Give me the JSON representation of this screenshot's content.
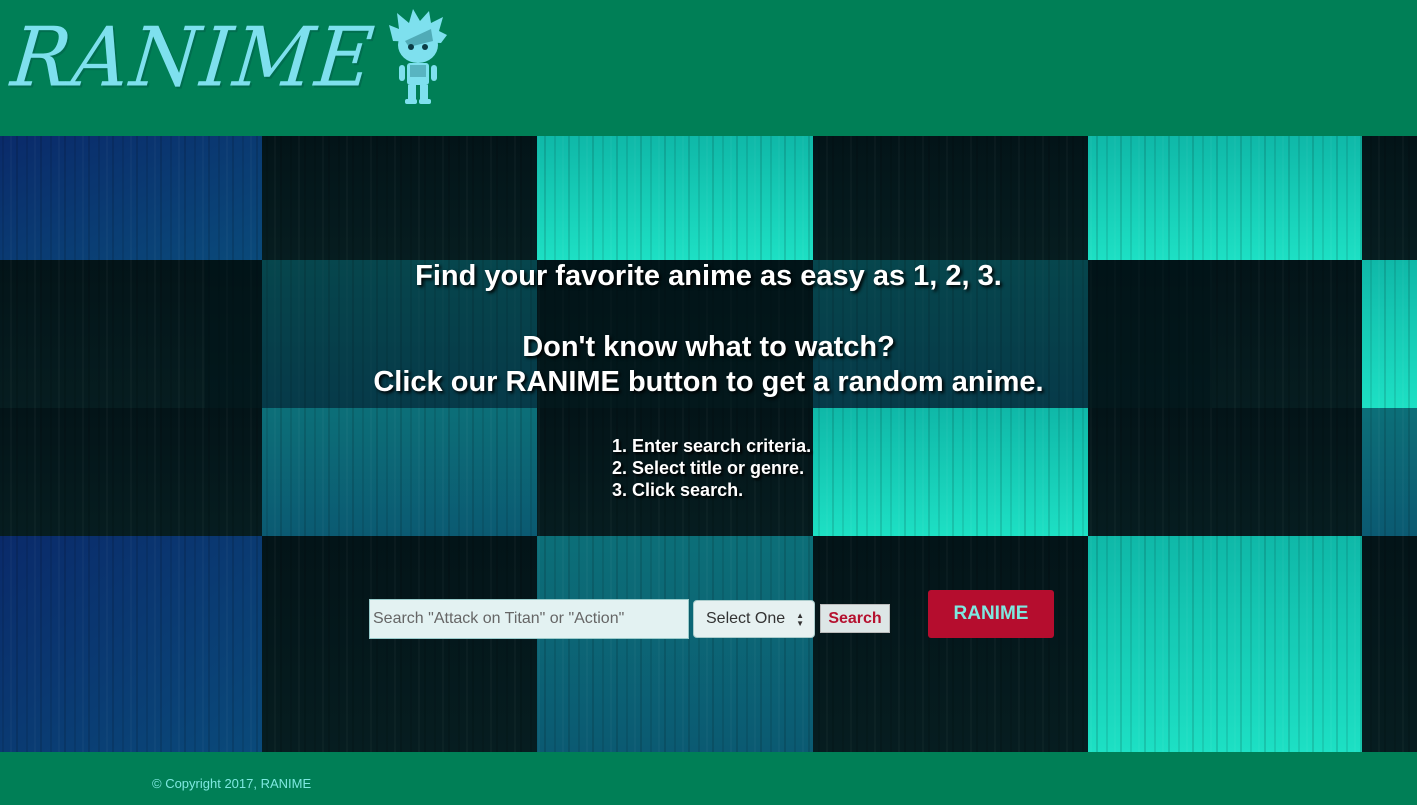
{
  "header": {
    "logo_text": "RANIME",
    "mascot_icon": "chibi-boy-icon"
  },
  "hero": {
    "headline": "Find your favorite anime as easy as 1, 2, 3.",
    "subline_1": "Don't know what to watch?",
    "subline_2": "Click our RANIME button to get a random anime.",
    "steps": [
      "1. Enter search criteria.",
      "2. Select title or genre.",
      "3. Click search."
    ]
  },
  "search": {
    "placeholder": "Search \"Attack on Titan\" or \"Action\"",
    "value": "",
    "select_value": "Select One",
    "button_label": "Search",
    "random_button_label": "RANIME"
  },
  "footer": {
    "copyright": "© Copyright 2017, RANIME"
  },
  "colors": {
    "brand_green": "#007f56",
    "accent_red": "#b50d2e",
    "accent_cyan": "#7ee8e0"
  }
}
